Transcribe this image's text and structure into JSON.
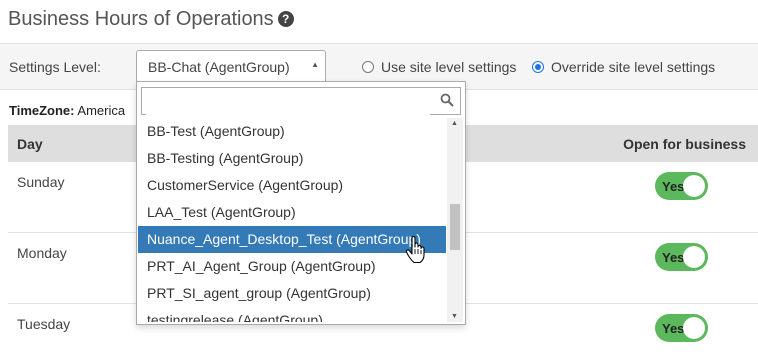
{
  "page": {
    "title": "Business Hours of Operations",
    "help_glyph": "?"
  },
  "settings": {
    "label": "Settings Level:",
    "selected": "BB-Chat (AgentGroup)",
    "radio_site": "Use site level settings",
    "radio_override": "Override site level settings",
    "radio_selected": "override"
  },
  "timezone": {
    "label": "TimeZone:",
    "value": "America"
  },
  "table": {
    "col_day": "Day",
    "col_open": "Open for business",
    "rows": [
      {
        "day": "Sunday",
        "open": "Yes"
      },
      {
        "day": "Monday",
        "open": "Yes"
      },
      {
        "day": "Tuesday",
        "open": "Yes"
      }
    ]
  },
  "dropdown": {
    "search_value": "",
    "items": [
      "BB-Test (AgentGroup)",
      "BB-Testing (AgentGroup)",
      "CustomerService (AgentGroup)",
      "LAA_Test (AgentGroup)",
      "Nuance_Agent_Desktop_Test (AgentGroup)",
      "PRT_AI_Agent_Group (AgentGroup)",
      "PRT_SI_agent_group (AgentGroup)",
      "testingrelease (AgentGroup)"
    ],
    "highlighted_index": 4
  },
  "colors": {
    "toggle_on": "#5cb85c",
    "highlight": "#337ab7",
    "radio_accent": "#1a73e8"
  },
  "icons": {
    "help": "help-icon",
    "search": "search-icon",
    "cursor": "hand-pointer-icon"
  }
}
